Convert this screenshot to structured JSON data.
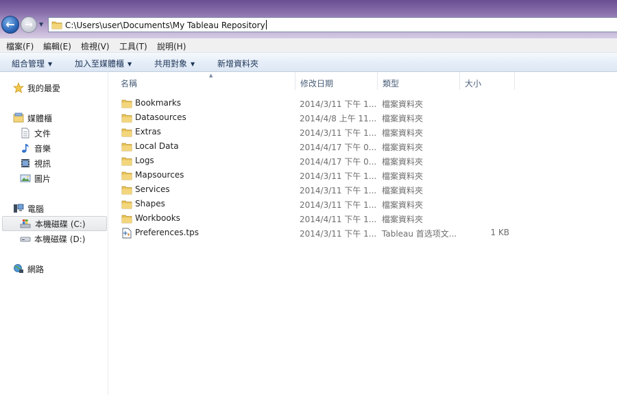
{
  "address": {
    "path": "C:\\Users\\user\\Documents\\My Tableau Repository"
  },
  "menubar": {
    "items": [
      "檔案(F)",
      "編輯(E)",
      "檢視(V)",
      "工具(T)",
      "說明(H)"
    ]
  },
  "commandbar": {
    "organize": "組合管理",
    "include_library": "加入至媒體櫃",
    "share": "共用對象",
    "new_folder": "新增資料夾"
  },
  "navpane": {
    "favorites": "我的最愛",
    "libraries": "媒體櫃",
    "documents": "文件",
    "music": "音樂",
    "videos": "視訊",
    "pictures": "圖片",
    "computer": "電腦",
    "drive_c": "本機磁碟 (C:)",
    "drive_d": "本機磁碟 (D:)",
    "network": "網路"
  },
  "columns": {
    "name": "名稱",
    "date": "修改日期",
    "type": "類型",
    "size": "大小"
  },
  "files": [
    {
      "name": "Bookmarks",
      "date": "2014/3/11 下午 1...",
      "type": "檔案資料夾",
      "size": "",
      "kind": "folder-icon"
    },
    {
      "name": "Datasources",
      "date": "2014/4/8 上午 11...",
      "type": "檔案資料夾",
      "size": "",
      "kind": "folder-icon"
    },
    {
      "name": "Extras",
      "date": "2014/3/11 下午 1...",
      "type": "檔案資料夾",
      "size": "",
      "kind": "folder-icon"
    },
    {
      "name": "Local Data",
      "date": "2014/4/17 下午 0...",
      "type": "檔案資料夾",
      "size": "",
      "kind": "folder-icon"
    },
    {
      "name": "Logs",
      "date": "2014/4/17 下午 0...",
      "type": "檔案資料夾",
      "size": "",
      "kind": "folder-icon"
    },
    {
      "name": "Mapsources",
      "date": "2014/3/11 下午 1...",
      "type": "檔案資料夾",
      "size": "",
      "kind": "folder-icon"
    },
    {
      "name": "Services",
      "date": "2014/3/11 下午 1...",
      "type": "檔案資料夾",
      "size": "",
      "kind": "folder-icon"
    },
    {
      "name": "Shapes",
      "date": "2014/3/11 下午 1...",
      "type": "檔案資料夾",
      "size": "",
      "kind": "folder-icon"
    },
    {
      "name": "Workbooks",
      "date": "2014/4/11 下午 1...",
      "type": "檔案資料夾",
      "size": "",
      "kind": "folder-icon"
    },
    {
      "name": "Preferences.tps",
      "date": "2014/3/11 下午 1...",
      "type": "Tableau 首选项文...",
      "size": "1 KB",
      "kind": "tableau-file-icon"
    }
  ],
  "colors": {
    "title_gradient_top": "#6a4e92",
    "commandbar_text": "#1e3559",
    "muted_text": "#6d6d6d",
    "folder_yellow": "#e8c35a"
  }
}
